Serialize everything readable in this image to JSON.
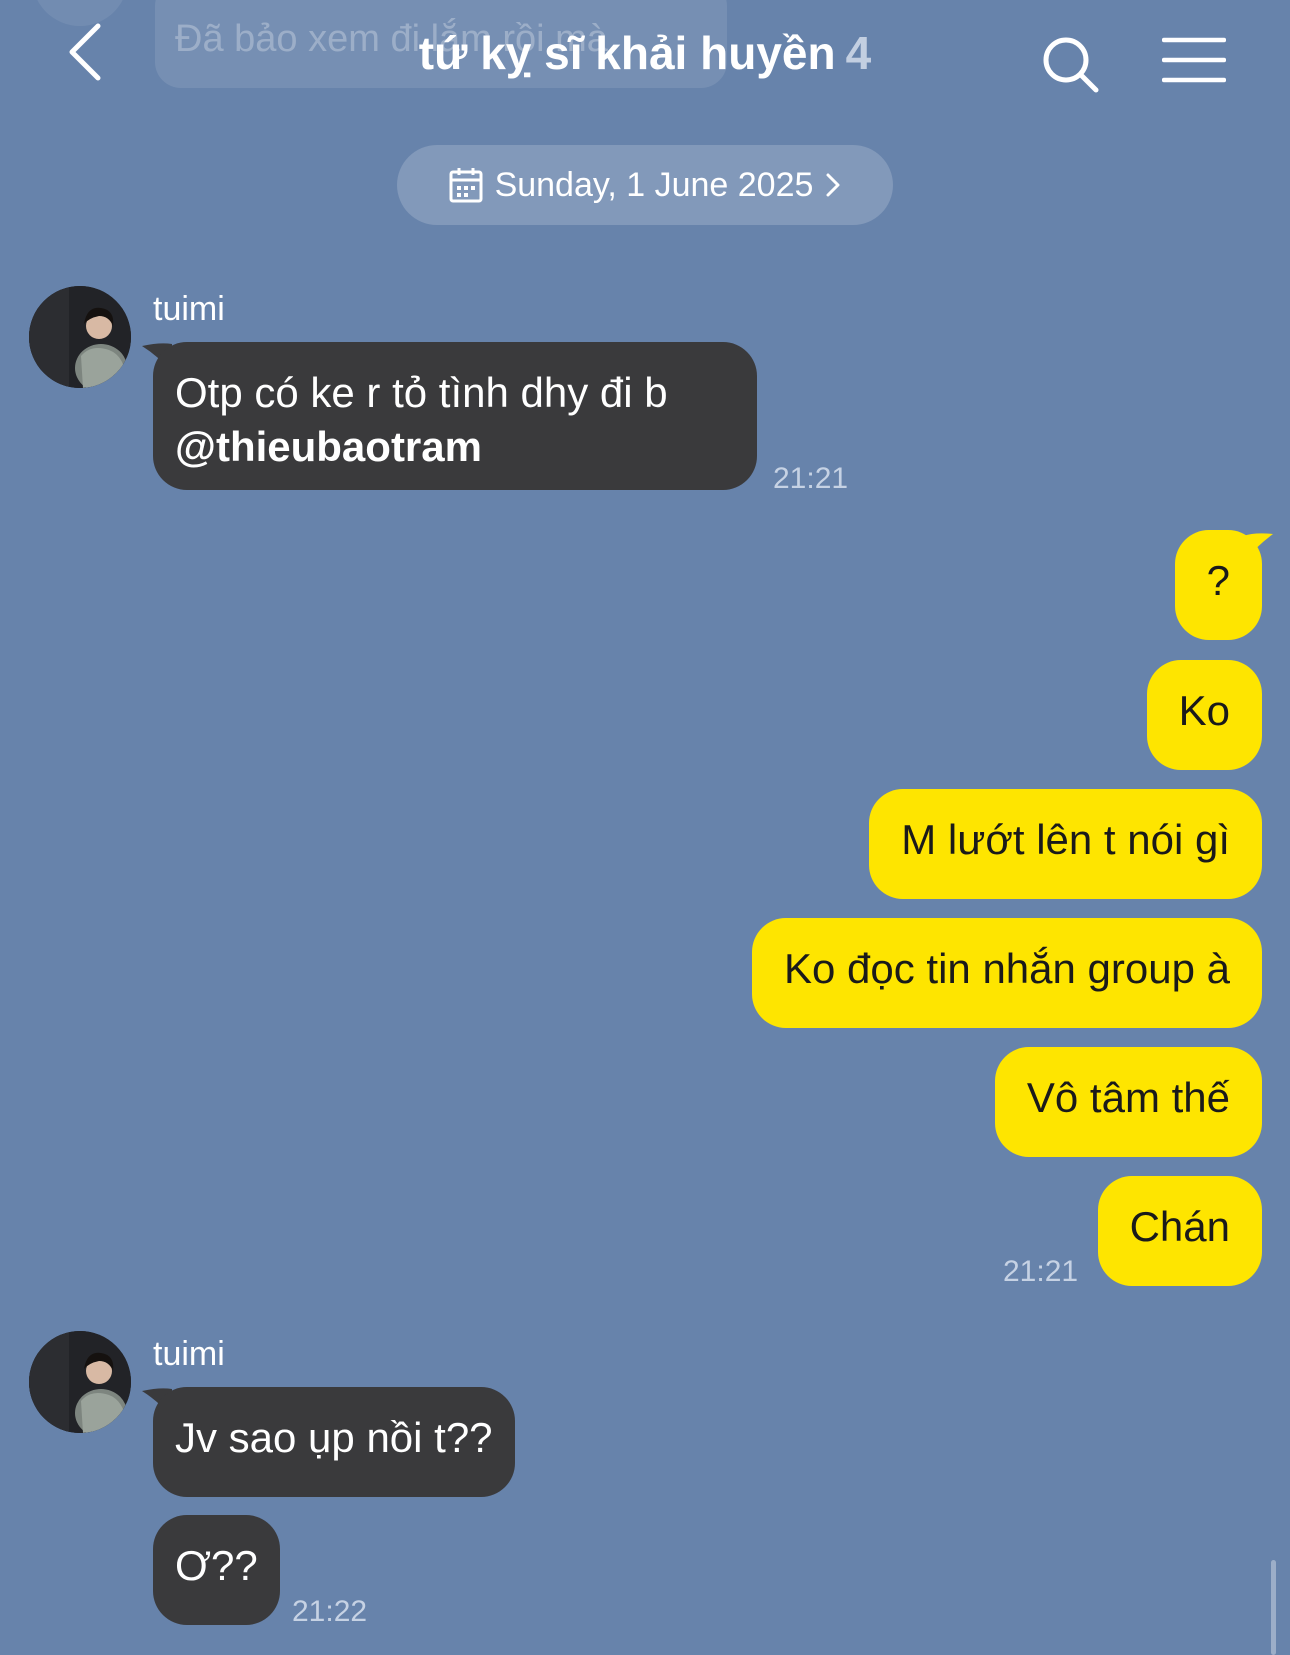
{
  "header": {
    "back_icon": "chevron-left-icon",
    "title": "tứ kỵ sĩ khải huyền",
    "member_count": "4",
    "search_icon": "search-icon",
    "menu_icon": "hamburger-menu-icon",
    "pinned_preview": "Đã bảo xem đi lắm rồi mà"
  },
  "date_divider": {
    "label": "Sunday, 1 June 2025",
    "icon": "calendar-icon",
    "chevron": "chevron-right-icon"
  },
  "messages": [
    {
      "sender": "tuimi",
      "lines": [
        "Otp có ke r tỏ tình dhy đi b",
        "@thieubaotram"
      ],
      "time": "21:21",
      "direction": "incoming"
    },
    {
      "text": "?",
      "direction": "outgoing"
    },
    {
      "text": "Ko",
      "direction": "outgoing"
    },
    {
      "text": "M lướt lên t nói gì",
      "direction": "outgoing"
    },
    {
      "text": "Ko đọc tin nhắn group à",
      "direction": "outgoing"
    },
    {
      "text": "Vô tâm thế",
      "direction": "outgoing"
    },
    {
      "text": "Chán",
      "direction": "outgoing",
      "time": "21:21"
    },
    {
      "sender": "tuimi",
      "text": "Jv sao ụp nồi t??",
      "direction": "incoming"
    },
    {
      "text": "Ơ??",
      "direction": "incoming",
      "time": "21:22"
    }
  ],
  "colors": {
    "background": "#6783ab",
    "incoming_bubble": "#3a3a3c",
    "outgoing_bubble": "#fee500",
    "timestamp": "#c6d2e4"
  }
}
